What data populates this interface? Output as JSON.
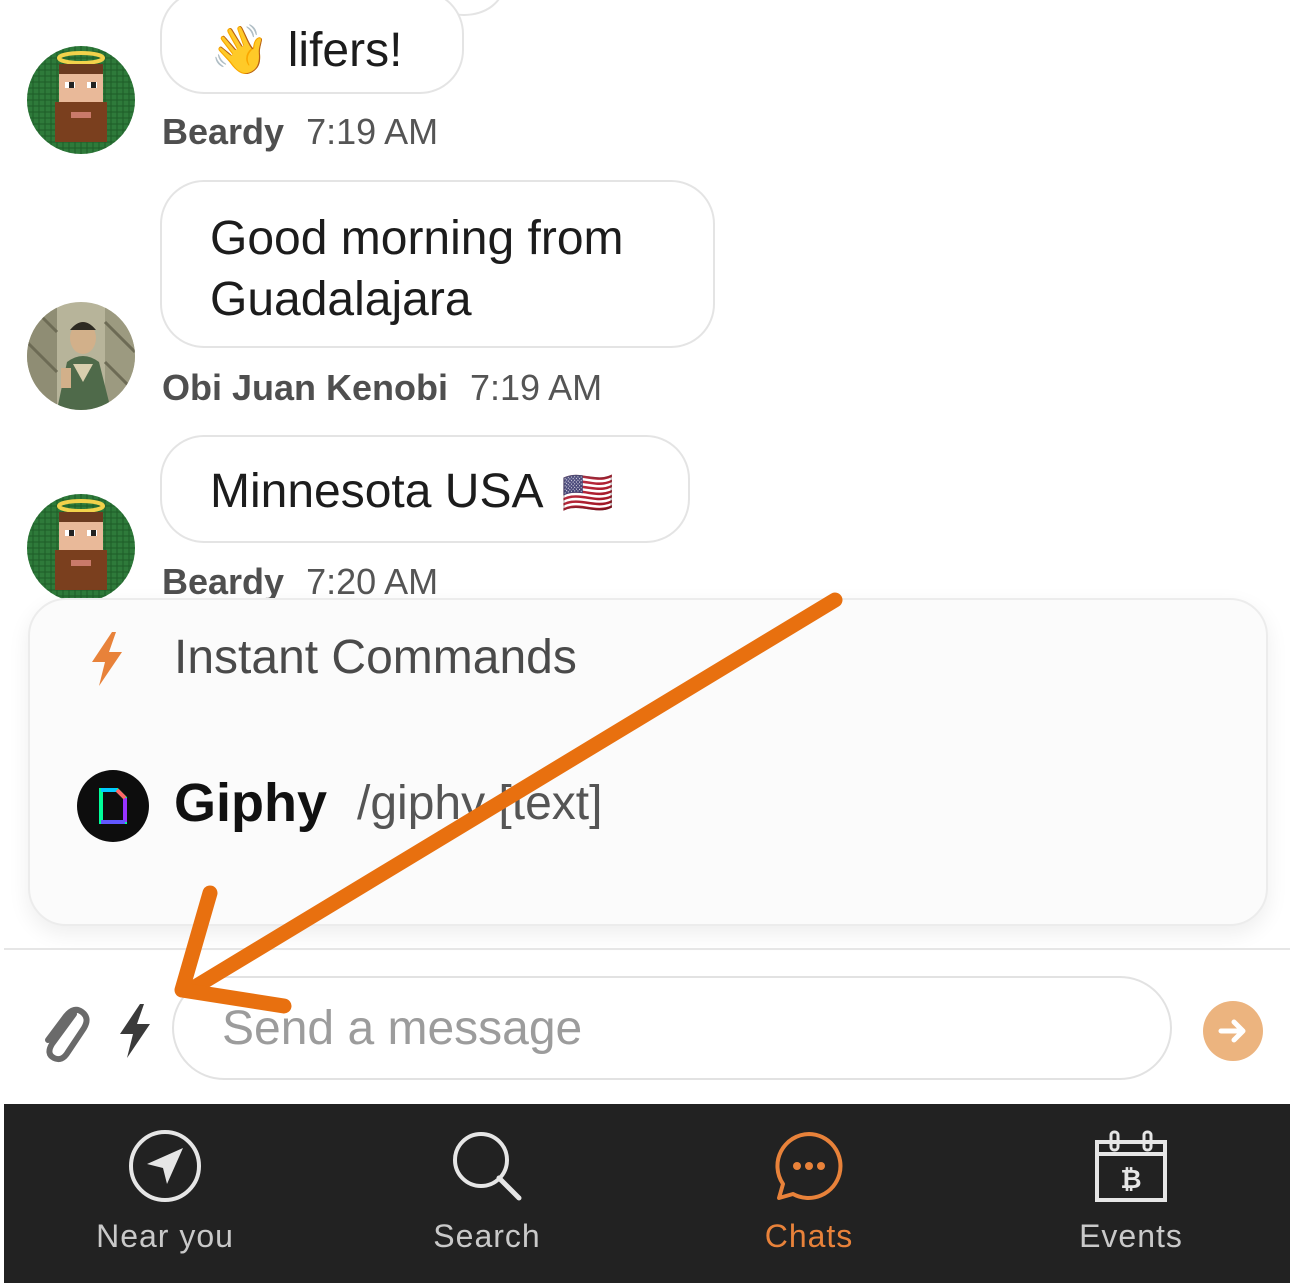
{
  "messages": [
    {
      "text": "lifers!",
      "emoji": "👋",
      "author": "Beardy",
      "time": "7:19 AM"
    },
    {
      "text_lines": [
        "Good morning from",
        "Guadalajara"
      ],
      "author": "Obi Juan Kenobi",
      "time": "7:19 AM"
    },
    {
      "text": "Minnesota USA",
      "emoji": "🇺🇸",
      "author": "Beardy",
      "time": "7:20 AM"
    }
  ],
  "instant_commands": {
    "title": "Instant Commands",
    "items": [
      {
        "name": "Giphy",
        "args": "/giphy [text]"
      }
    ]
  },
  "composer": {
    "placeholder": "Send a message"
  },
  "tabs": [
    {
      "label": "Near you",
      "icon": "navigation-icon"
    },
    {
      "label": "Search",
      "icon": "search-icon"
    },
    {
      "label": "Chats",
      "icon": "chat-bubble-icon",
      "active": true
    },
    {
      "label": "Events",
      "icon": "calendar-bitcoin-icon"
    }
  ],
  "colors": {
    "accent": "#e8823a",
    "annotation_arrow": "#e8700f",
    "tabbar_bg": "#222222",
    "send_button": "#ecb47f"
  }
}
